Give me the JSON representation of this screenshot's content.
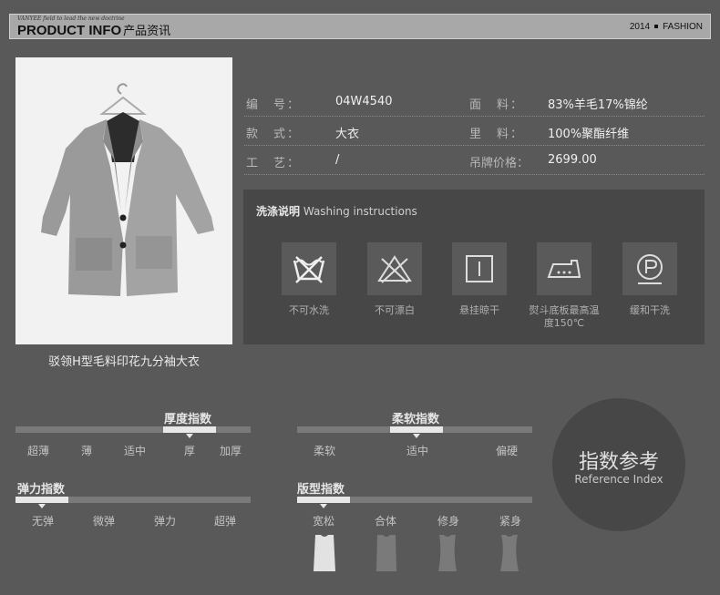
{
  "header": {
    "tagline": "VANYEE field to lead the new doctrine",
    "title": "PRODUCT INFO",
    "title_cn": "产品资讯",
    "year": "2014",
    "right_label": "FASHION"
  },
  "product": {
    "caption": "驳领H型毛料印花九分袖大衣"
  },
  "info": {
    "rows": [
      {
        "label1": "编　号：",
        "value1": "04W4540",
        "label2": "面　料：",
        "value2": "83%羊毛17%锦纶"
      },
      {
        "label1": "款　式：",
        "value1": "大衣",
        "label2": "里　料：",
        "value2": "100%聚酯纤维"
      },
      {
        "label1": "工　艺：",
        "value1": "/",
        "label2": "吊牌价格：",
        "value2": "2699.00"
      }
    ]
  },
  "washing": {
    "title_cn": "洗涤说明",
    "title_en": "Washing instructions",
    "items": [
      {
        "label": "不可水洗",
        "icon": "no-wash-icon"
      },
      {
        "label": "不可漂白",
        "icon": "no-bleach-icon"
      },
      {
        "label": "悬挂晾干",
        "icon": "hang-dry-icon"
      },
      {
        "label": "熨斗底板最高温度150℃",
        "icon": "iron-icon"
      },
      {
        "label": "缓和干洗",
        "icon": "dry-clean-icon"
      }
    ]
  },
  "indices": {
    "thickness": {
      "title": "厚度指数",
      "options": [
        "超薄",
        "薄",
        "适中",
        "厚",
        "加厚"
      ],
      "selected": "厚"
    },
    "softness": {
      "title": "柔软指数",
      "options": [
        "柔软",
        "适中",
        "偏硬"
      ],
      "selected": "适中"
    },
    "elasticity": {
      "title": "弹力指数",
      "options": [
        "无弹",
        "微弹",
        "弹力",
        "超弹"
      ],
      "selected": "无弹"
    },
    "fit": {
      "title": "版型指数",
      "options": [
        "宽松",
        "合体",
        "修身",
        "紧身"
      ],
      "selected": "宽松"
    }
  },
  "reference": {
    "title_cn": "指数参考",
    "title_en": "Reference Index"
  },
  "colors": {
    "background": "#595959",
    "panel": "#474747",
    "header": "#a8a8a8",
    "highlight": "#e8e8e8"
  }
}
